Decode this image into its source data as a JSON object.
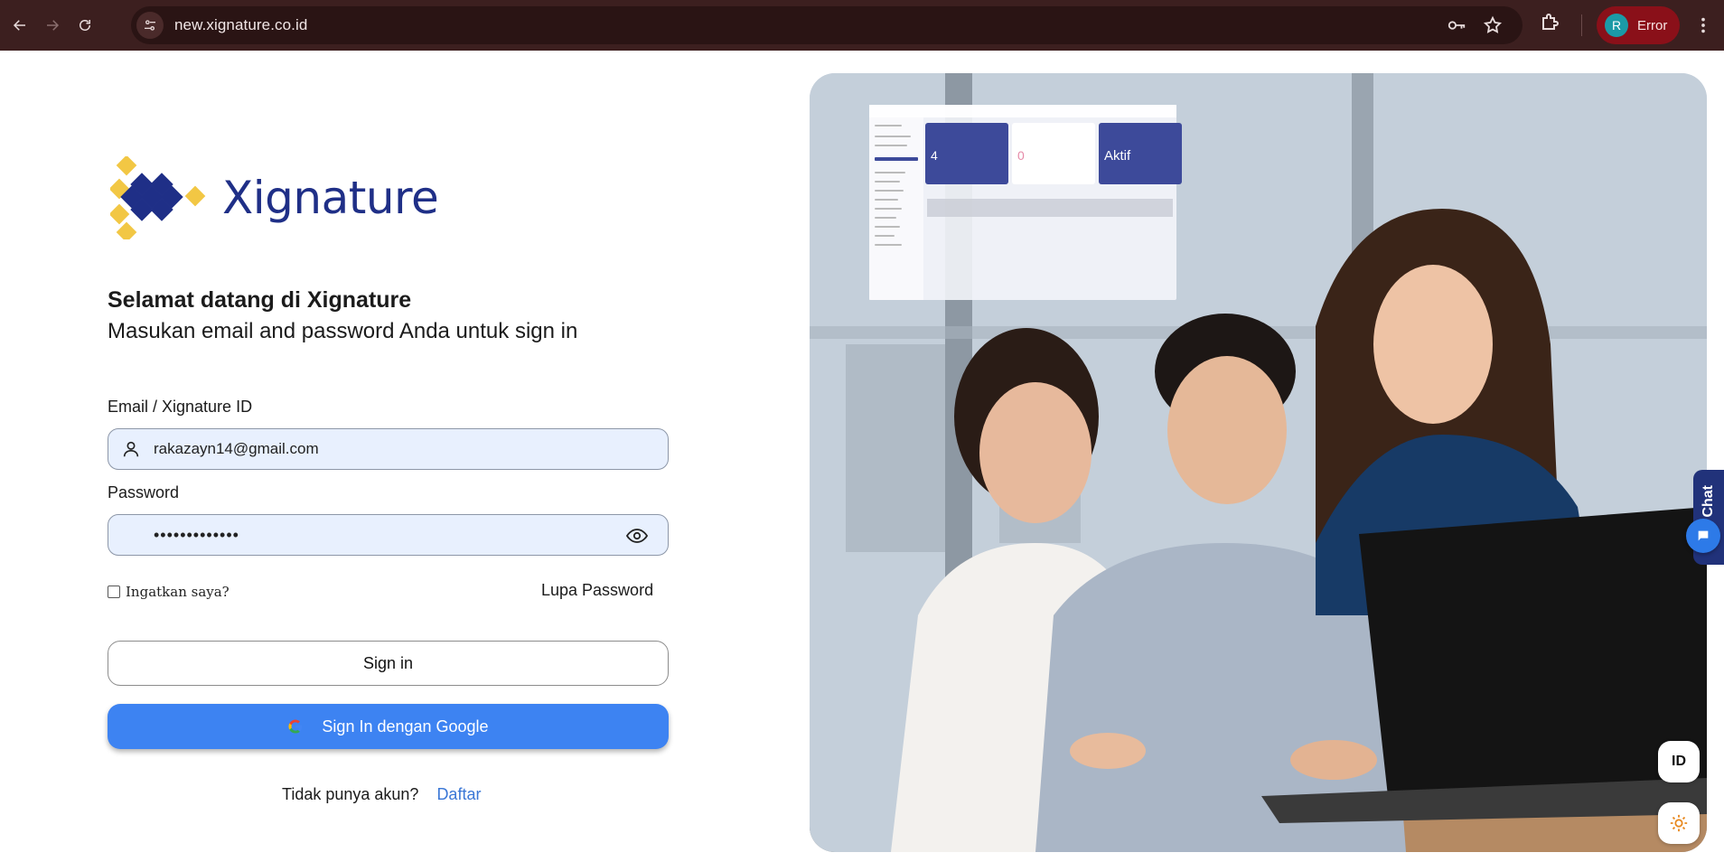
{
  "browser": {
    "url": "new.xignature.co.id",
    "profile_initial": "R",
    "profile_label": "Error"
  },
  "brand": {
    "name": "Xignature",
    "primary_color": "#1f2f87",
    "accent_color": "#f2c744"
  },
  "login": {
    "welcome": "Selamat datang di Xignature",
    "subtitle": "Masukan email and password Anda untuk sign in",
    "email_label": "Email / Xignature ID",
    "email_value": "rakazayn14@gmail.com",
    "password_label": "Password",
    "password_value": "•••••••••••••",
    "remember_label": "Ingatkan saya?",
    "forgot_label": "Lupa Password",
    "signin_label": "Sign in",
    "google_label": "Sign In dengan Google",
    "no_account_text": "Tidak punya akun?",
    "signup_label": "Daftar"
  },
  "hero_mock": {
    "card1_value": "4",
    "card2_value": "0",
    "card3_value": "Aktif"
  },
  "widgets": {
    "live_chat_label": "Live Chat",
    "language_label": "ID"
  },
  "icons": {
    "back": "arrow-left-icon",
    "forward": "arrow-right-icon",
    "reload": "reload-icon",
    "site_info": "tune-icon",
    "password_key": "key-icon",
    "bookmark": "star-icon",
    "extensions": "puzzle-icon",
    "menu": "kebab-menu-icon",
    "user": "user-icon",
    "eye": "eye-icon",
    "google": "google-icon",
    "chat": "chat-bubble-icon",
    "theme": "sun-icon"
  }
}
